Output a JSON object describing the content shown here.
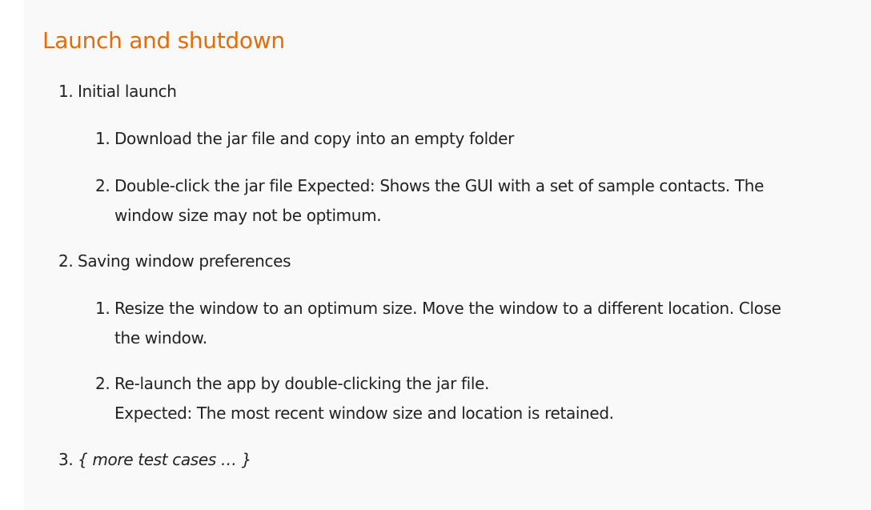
{
  "section": {
    "title": "Launch and shutdown",
    "items": [
      {
        "number": "1.",
        "label": "Initial launch",
        "subitems": [
          {
            "number": "1.",
            "text": "Download the jar file and copy into an empty folder"
          },
          {
            "number": "2.",
            "text_line1": "Double-click the jar file Expected: Shows the GUI with a set of sample contacts. The",
            "text_line2": "window size may not be optimum."
          }
        ]
      },
      {
        "number": "2.",
        "label": "Saving window preferences",
        "subitems": [
          {
            "number": "1.",
            "text_line1": "Resize the window to an optimum size. Move the window to a different location. Close",
            "text_line2": "the window."
          },
          {
            "number": "2.",
            "text_line1": "Re-launch the app by double-clicking the jar file.",
            "text_line2": "Expected: The most recent window size and location is retained."
          }
        ]
      },
      {
        "number": "3.",
        "label": "{ more test cases … }"
      }
    ]
  },
  "colors": {
    "heading": "#e46c0a",
    "text": "#222222",
    "background": "#f9f9f9"
  }
}
